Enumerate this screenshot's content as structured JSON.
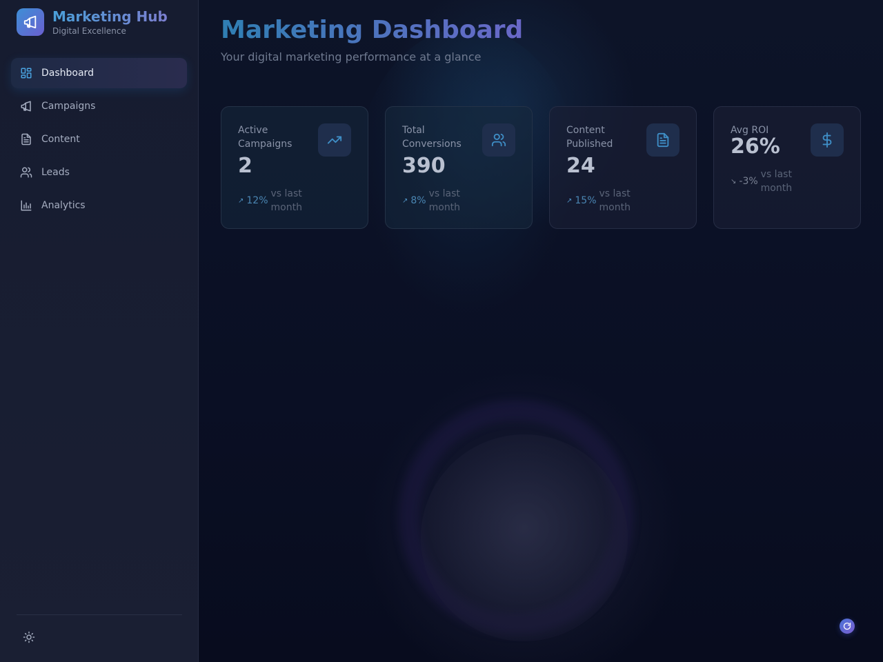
{
  "brand": {
    "title": "Marketing Hub",
    "subtitle": "Digital Excellence",
    "icon": "megaphone-icon"
  },
  "sidebar": {
    "items": [
      {
        "label": "Dashboard",
        "icon": "dashboard-grid-icon",
        "active": true
      },
      {
        "label": "Campaigns",
        "icon": "megaphone-icon",
        "active": false
      },
      {
        "label": "Content",
        "icon": "document-icon",
        "active": false
      },
      {
        "label": "Leads",
        "icon": "users-icon",
        "active": false
      },
      {
        "label": "Analytics",
        "icon": "bar-chart-icon",
        "active": false
      }
    ],
    "theme_toggle_icon": "sun-icon"
  },
  "header": {
    "title": "Marketing Dashboard",
    "subtitle": "Your digital marketing performance at a glance"
  },
  "stats": [
    {
      "label": "Active Campaigns",
      "value": "2",
      "trend": "12%",
      "trend_direction": "up",
      "note": "vs last month",
      "icon": "trending-up-icon"
    },
    {
      "label": "Total Conversions",
      "value": "390",
      "trend": "8%",
      "trend_direction": "up",
      "note": "vs last month",
      "icon": "users-icon"
    },
    {
      "label": "Content Published",
      "value": "24",
      "trend": "15%",
      "trend_direction": "up",
      "note": "vs last month",
      "icon": "document-icon"
    },
    {
      "label": "Avg ROI",
      "value": "26%",
      "trend": "-3%",
      "trend_direction": "down",
      "note": "vs last month",
      "icon": "dollar-icon"
    }
  ],
  "trend_symbols": {
    "up": "↗",
    "down": "↘"
  },
  "colors": {
    "accent_blue": "#4a9fd8",
    "accent_purple": "#6a68c8",
    "background": "#0b1022",
    "sidebar": "#161c30"
  },
  "fab_icon": "refresh-icon"
}
